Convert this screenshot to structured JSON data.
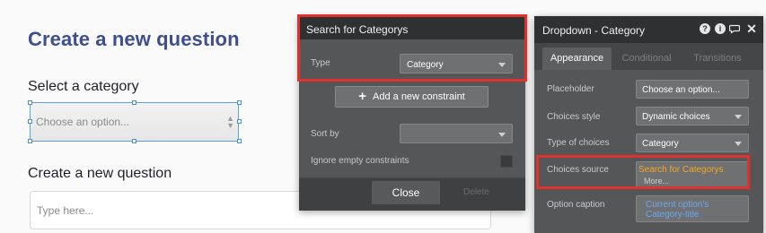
{
  "canvas": {
    "page_title": "Create a new question",
    "select_label": "Select a category",
    "dropdown_placeholder": "Choose an option...",
    "question_label": "Create a new question",
    "question_placeholder": "Type here..."
  },
  "search_panel": {
    "title": "Search for Categorys",
    "type_label": "Type",
    "type_value": "Category",
    "add_constraint_label": "Add a new constraint",
    "sort_by_label": "Sort by",
    "sort_by_value": "",
    "ignore_empty_label": "Ignore empty constraints",
    "ignore_empty_checked": false,
    "close_label": "Close",
    "delete_label": "Delete"
  },
  "property_editor": {
    "title": "Dropdown - Category",
    "header_icons": [
      "help-icon",
      "info-icon",
      "comment-icon",
      "close-icon"
    ],
    "tabs": [
      {
        "label": "Appearance",
        "active": true
      },
      {
        "label": "Conditional",
        "active": false
      },
      {
        "label": "Transitions",
        "active": false
      }
    ],
    "fields": {
      "placeholder_label": "Placeholder",
      "placeholder_value": "Choose an option...",
      "choices_style_label": "Choices style",
      "choices_style_value": "Dynamic choices",
      "type_of_choices_label": "Type of choices",
      "type_of_choices_value": "Category",
      "choices_source_label": "Choices source",
      "choices_source_value": "Search for Categorys",
      "choices_source_more": "More...",
      "option_caption_label": "Option caption",
      "option_caption_value": "Current option's Category-title"
    }
  },
  "colors": {
    "highlight_red": "#e2302b",
    "title_blue": "#3f4e8c",
    "expression_orange": "#f5a623",
    "expression_blue": "#6aa9f0",
    "panel_bg": "#555657",
    "panel_header": "#2f3031"
  }
}
